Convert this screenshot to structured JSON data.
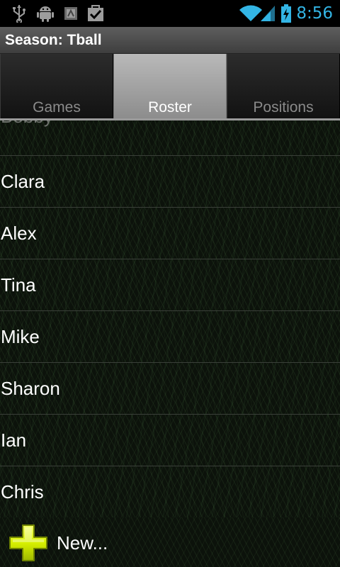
{
  "status_bar": {
    "time": "8:56",
    "icons": [
      "usb-icon",
      "android-debug-icon",
      "3g-icon",
      "task-done-icon",
      "wifi-icon",
      "signal-icon",
      "battery-charging-icon"
    ],
    "accent_color": "#33b5e5"
  },
  "title_bar": {
    "title": "Season: Tball"
  },
  "tabs": [
    {
      "label": "Games",
      "selected": false
    },
    {
      "label": "Roster",
      "selected": true
    },
    {
      "label": "Positions",
      "selected": false
    }
  ],
  "roster": {
    "partial_item": "Bobby",
    "items": [
      "Clara",
      "Alex",
      "Tina",
      "Mike",
      "Sharon",
      "Ian",
      "Chris"
    ]
  },
  "footer": {
    "new_label": "New...",
    "icon": "plus-icon",
    "icon_color": "#d6f000"
  }
}
